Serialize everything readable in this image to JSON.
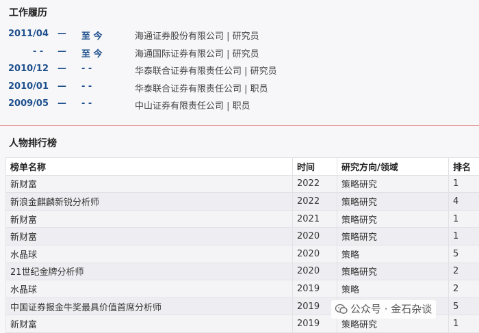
{
  "work_history": {
    "title": "工作履历",
    "rows": [
      {
        "start": "2011/04",
        "dash": "—",
        "end": "至 今",
        "desc": "海通证券股份有限公司 | 研究员"
      },
      {
        "start": "- -",
        "dash": "—",
        "end": "至 今",
        "desc": "海通国际证券有限公司 | 研究员"
      },
      {
        "start": "2010/12",
        "dash": "—",
        "end": "- -",
        "desc": "华泰联合证券有限责任公司 | 研究员"
      },
      {
        "start": "2010/01",
        "dash": "—",
        "end": "- -",
        "desc": "华泰联合证券有限责任公司 | 职员"
      },
      {
        "start": "2009/05",
        "dash": "—",
        "end": "- -",
        "desc": "中山证券有限责任公司 | 职员"
      }
    ]
  },
  "ranking": {
    "title": "人物排行榜",
    "headers": [
      "榜单名称",
      "时间",
      "研究方向/领域",
      "排名"
    ],
    "rows": [
      [
        "新财富",
        "2022",
        "策略研究",
        "1"
      ],
      [
        "新浪金麒麟新锐分析师",
        "2022",
        "策略研究",
        "4"
      ],
      [
        "新财富",
        "2021",
        "策略研究",
        "1"
      ],
      [
        "新财富",
        "2020",
        "策略研究",
        "1"
      ],
      [
        "水晶球",
        "2020",
        "策略",
        "5"
      ],
      [
        "21世纪金牌分析师",
        "2020",
        "策略研究",
        "2"
      ],
      [
        "水晶球",
        "2019",
        "策略",
        "2"
      ],
      [
        "中国证券报金牛奖最具价值首席分析师",
        "2019",
        "",
        "5"
      ],
      [
        "新财富",
        "2019",
        "策略研究",
        "1"
      ]
    ]
  },
  "watermark": {
    "text": "公众号 · 金石杂谈",
    "icon": "wechat-icon"
  }
}
